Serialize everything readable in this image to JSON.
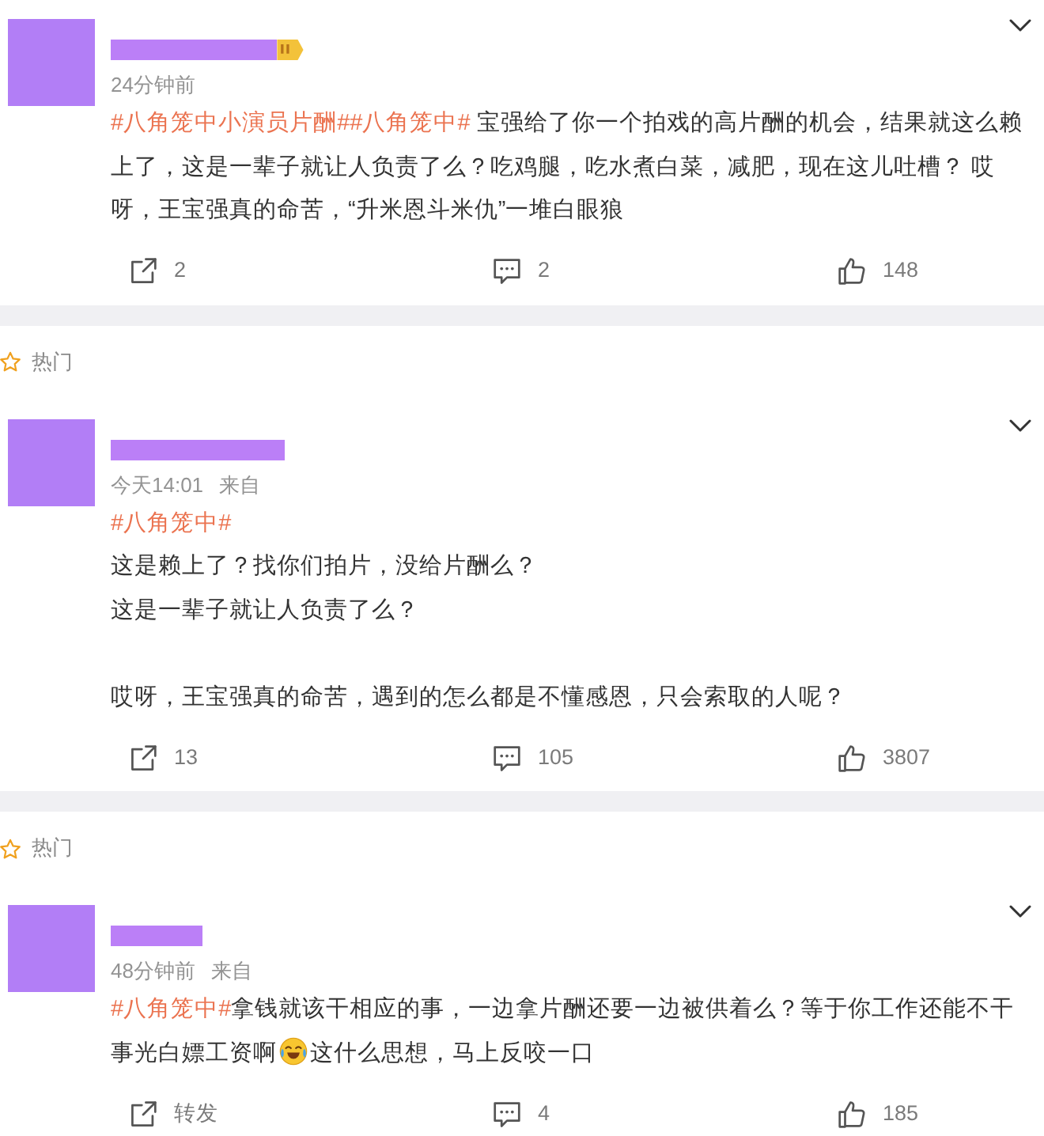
{
  "posts": [
    {
      "vip_badge": true,
      "time": "24分钟前",
      "paragraphs": [
        {
          "lines": [
            {
              "segments": [
                {
                  "kind": "hashtag",
                  "text": "#八角笼中小演员片酬#"
                },
                {
                  "kind": "hashtag",
                  "text": "#八角笼中#"
                },
                {
                  "kind": "text",
                  "text": " 宝强给了你一个拍戏的高片酬的机会，结果就这么赖上了，这是一辈子就让人负责了么？吃鸡腿，吃水煮白菜，减肥，现在这儿吐槽？ 哎呀，王宝强真的命苦，“升米恩斗米仇”一堆白眼狼"
                }
              ]
            }
          ]
        }
      ],
      "actions": [
        {
          "kind": "repost",
          "label": "2"
        },
        {
          "kind": "comment",
          "label": "2"
        },
        {
          "kind": "like",
          "label": "148"
        }
      ]
    },
    {
      "hot": "热门",
      "vip_badge": false,
      "time": "今天14:01",
      "source": "来自",
      "paragraphs": [
        {
          "lines": [
            {
              "segments": [
                {
                  "kind": "hashtag",
                  "text": "#八角笼中#"
                }
              ]
            },
            {
              "segments": [
                {
                  "kind": "text",
                  "text": "这是赖上了？找你们拍片，没给片酬么？"
                }
              ]
            },
            {
              "segments": [
                {
                  "kind": "text",
                  "text": "这是一辈子就让人负责了么？"
                }
              ]
            }
          ]
        },
        {
          "lines": [
            {
              "segments": [
                {
                  "kind": "text",
                  "text": "哎呀，王宝强真的命苦，遇到的怎么都是不懂感恩，只会索取的人呢？"
                }
              ]
            }
          ]
        }
      ],
      "actions": [
        {
          "kind": "repost",
          "label": "13"
        },
        {
          "kind": "comment",
          "label": "105"
        },
        {
          "kind": "like",
          "label": "3807"
        }
      ]
    },
    {
      "hot": "热门",
      "vip_badge": false,
      "time": "48分钟前",
      "source": "来自",
      "paragraphs": [
        {
          "lines": [
            {
              "segments": [
                {
                  "kind": "hashtag",
                  "text": "#八角笼中#"
                },
                {
                  "kind": "text",
                  "text": "拿钱就该干相应的事，一边拿片酬还要一边被供着么？等于你工作还能不干事光白嫖工资啊"
                },
                {
                  "kind": "emoji"
                },
                {
                  "kind": "text",
                  "text": "这什么思想，马上反咬一口"
                }
              ]
            }
          ]
        }
      ],
      "actions": [
        {
          "kind": "repost",
          "label": "转发"
        },
        {
          "kind": "comment",
          "label": "4"
        },
        {
          "kind": "like",
          "label": "185"
        }
      ]
    }
  ]
}
